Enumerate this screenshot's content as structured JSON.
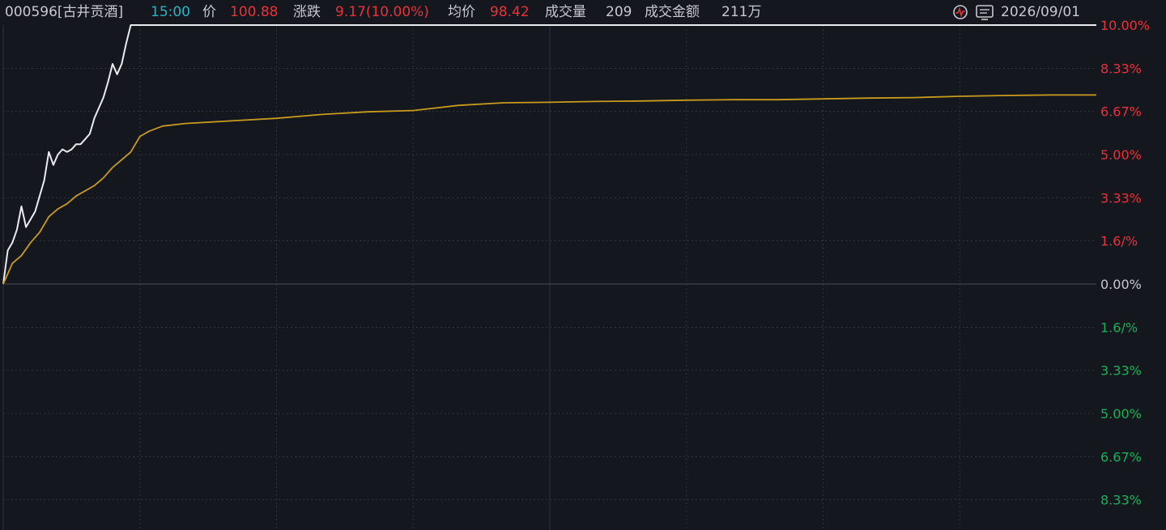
{
  "header": {
    "code": "000596[古井贡酒]",
    "time": "15:00",
    "price_label": "价",
    "price": "100.88",
    "change_label": "涨跌",
    "change": "9.17(10.00%)",
    "avg_label": "均价",
    "avg": "98.42",
    "volume_label": "成交量",
    "volume": "209",
    "amount_label": "成交金额",
    "amount": "211万",
    "icons": [
      "pulse-icon",
      "monitor-icon"
    ],
    "date": "2026/09/01"
  },
  "colors": {
    "up": "#e8323c",
    "down": "#1aaf5a",
    "price_line": "#e9ebee",
    "avg_line": "#c89b1e",
    "grid": "#2e323a",
    "cyan": "#2bb4c4"
  },
  "chart_data": {
    "type": "line",
    "ylim": [
      -10,
      10
    ],
    "y_tick_values": [
      10,
      8.33,
      6.67,
      5.0,
      3.33,
      1.67,
      0,
      -1.67,
      -3.33,
      -5.0,
      -6.67,
      -8.33
    ],
    "y_tick_labels": [
      "10.00%",
      "8.33%",
      "6.67%",
      "5.00%",
      "3.33%",
      "1.6/%",
      "0.00%",
      "1.6/%",
      "3.33%",
      "5.00%",
      "6.67%",
      "8.33%"
    ],
    "series": [
      {
        "key": "price",
        "x": [
          0,
          1,
          2,
          3,
          4,
          5,
          6,
          7,
          8,
          9,
          10,
          11,
          12,
          13,
          14,
          15,
          16,
          17,
          18,
          19,
          20,
          21,
          22,
          23,
          24,
          25,
          26,
          27,
          28,
          29,
          30,
          31,
          32,
          33,
          34,
          35,
          36,
          40,
          50,
          60,
          80,
          100,
          120,
          150,
          200,
          240
        ],
        "values": [
          0.0,
          1.3,
          1.6,
          2.1,
          3.0,
          2.2,
          2.5,
          2.8,
          3.4,
          4.0,
          5.1,
          4.6,
          5.0,
          5.2,
          5.1,
          5.2,
          5.4,
          5.4,
          5.6,
          5.8,
          6.4,
          6.8,
          7.2,
          7.8,
          8.5,
          8.1,
          8.5,
          9.3,
          10.0,
          10.0,
          10.0,
          10.0,
          10.0,
          10.0,
          10.0,
          10.0,
          10.0,
          10.0,
          10.0,
          10.0,
          10.0,
          10.0,
          10.0,
          10.0,
          10.0,
          10.0
        ]
      },
      {
        "key": "avg",
        "x": [
          0,
          2,
          4,
          6,
          8,
          10,
          12,
          14,
          16,
          18,
          20,
          22,
          24,
          26,
          28,
          30,
          32,
          35,
          40,
          50,
          60,
          70,
          80,
          90,
          100,
          110,
          120,
          130,
          140,
          150,
          160,
          170,
          180,
          190,
          200,
          210,
          220,
          230,
          240
        ],
        "values": [
          0.0,
          0.8,
          1.1,
          1.6,
          2.0,
          2.6,
          2.9,
          3.1,
          3.4,
          3.6,
          3.8,
          4.1,
          4.5,
          4.8,
          5.1,
          5.7,
          5.9,
          6.1,
          6.2,
          6.3,
          6.4,
          6.55,
          6.65,
          6.7,
          6.9,
          7.0,
          7.02,
          7.05,
          7.07,
          7.1,
          7.12,
          7.12,
          7.15,
          7.18,
          7.2,
          7.25,
          7.28,
          7.3,
          7.3
        ]
      }
    ],
    "xlim": [
      0,
      240
    ]
  }
}
